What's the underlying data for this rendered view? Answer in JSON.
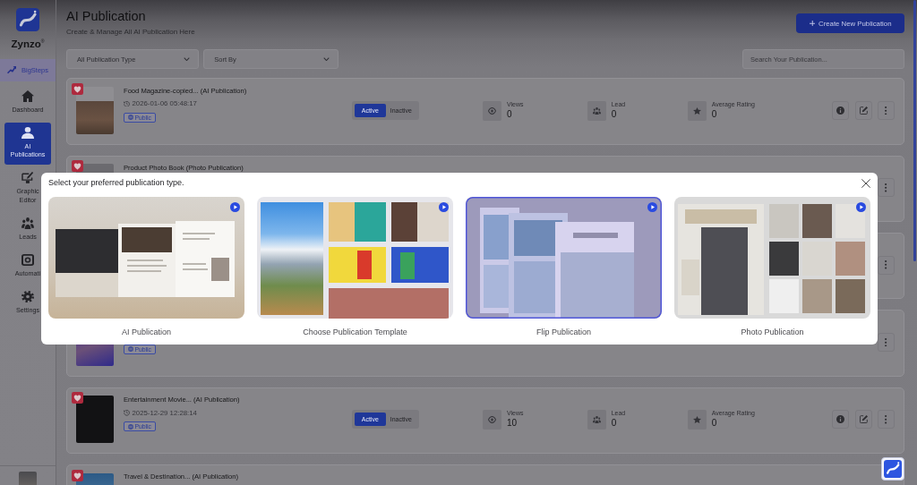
{
  "sidebar": {
    "brand": "Zynzo$^{®}$",
    "workspace": "BigSteps",
    "items": [
      {
        "label": "Dashboard",
        "selected": false
      },
      {
        "label": "AI Publications",
        "selected": true
      },
      {
        "label": "Graphic Editor",
        "selected": false
      },
      {
        "label": "Leads",
        "selected": false
      },
      {
        "label": "Automati",
        "selected": false
      },
      {
        "label": "Settings",
        "selected": false
      }
    ]
  },
  "header": {
    "title": "AI Publication",
    "subtitle": "Create & Manage All AI Publication Here",
    "create_button": "Create New Publication"
  },
  "filters": {
    "dropdowns": [
      "All Publication Type",
      "Sort By"
    ],
    "search": {
      "placeholder": "Search Your Publication..."
    }
  },
  "publications": [
    {
      "favorite": true,
      "thumbnail": true,
      "title": "Food Magazine-copied... (AI Publication)",
      "date": "2026-01-06 05:48:17",
      "visibility": "Public",
      "status": [
        {
          "label": "Active",
          "selected": true
        },
        {
          "label": "Inactive",
          "selected": false
        }
      ],
      "stats": [
        {
          "label": "Views",
          "value": "0"
        },
        {
          "label": "Lead",
          "value": "0"
        },
        {
          "label": "Average Rating",
          "value": "0"
        }
      ],
      "actions": [
        {
          "kind": "info"
        },
        {
          "kind": "edit"
        },
        {
          "kind": "more"
        }
      ]
    },
    {
      "favorite": true,
      "thumbnail": true,
      "title": "Product Photo Book (Photo Publication)",
      "actions": [
        {
          "kind": "more"
        }
      ]
    },
    {
      "actions": [
        {
          "kind": "more"
        }
      ]
    },
    {
      "thumbnail": true,
      "visibility": "Public",
      "actions": [
        {
          "kind": "more"
        }
      ]
    },
    {
      "favorite": true,
      "thumbnail": true,
      "title": "Entertainment Movie... (AI Publication)",
      "date": "2025-12-29 12:28:14",
      "visibility": "Public",
      "status": [
        {
          "label": "Active",
          "selected": true
        },
        {
          "label": "Inactive",
          "selected": false
        }
      ],
      "stats": [
        {
          "label": "Views",
          "value": "10"
        },
        {
          "label": "Lead",
          "value": "0"
        },
        {
          "label": "Average Rating",
          "value": "0"
        }
      ],
      "actions": [
        {
          "kind": "info"
        },
        {
          "kind": "edit"
        },
        {
          "kind": "more"
        }
      ]
    },
    {
      "favorite": true,
      "thumbnail": true,
      "title": "Travel & Destination... (AI Publication)"
    }
  ],
  "dialog": {
    "title": "Select your preferred publication type.",
    "options": [
      {
        "kind": "mockup",
        "label": "AI Publication",
        "selected": false
      },
      {
        "kind": "templates",
        "label": "Choose Publication Template",
        "selected": false
      },
      {
        "kind": "flip",
        "label": "Flip Publication",
        "selected": true
      },
      {
        "kind": "photo",
        "label": "Photo Publication",
        "selected": false
      }
    ]
  }
}
